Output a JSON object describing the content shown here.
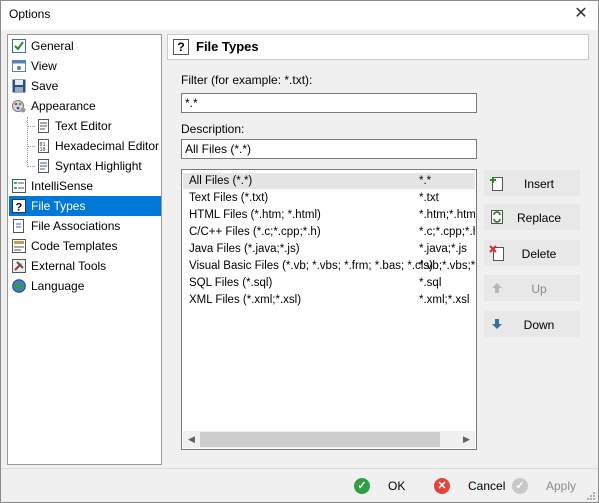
{
  "window": {
    "title": "Options"
  },
  "sidebar": {
    "items": [
      {
        "label": "General",
        "icon": "checkbox-icon"
      },
      {
        "label": "View",
        "icon": "view-icon"
      },
      {
        "label": "Save",
        "icon": "floppy-disk-icon"
      },
      {
        "label": "Appearance",
        "icon": "palette-gear-icon"
      },
      {
        "label": "Text Editor",
        "icon": "document-icon"
      },
      {
        "label": "Hexadecimal Editor",
        "icon": "binary-document-icon"
      },
      {
        "label": "Syntax Highlight",
        "icon": "highlight-document-icon"
      },
      {
        "label": "IntelliSense",
        "icon": "list-icon"
      },
      {
        "label": "File Types",
        "icon": "question-mark-icon"
      },
      {
        "label": "File Associations",
        "icon": "document-association-icon"
      },
      {
        "label": "Code Templates",
        "icon": "template-icon"
      },
      {
        "label": "External Tools",
        "icon": "tools-icon"
      },
      {
        "label": "Language",
        "icon": "globe-icon"
      }
    ],
    "selected_index": 8
  },
  "panel": {
    "title": "File Types",
    "filter_label": "Filter (for example: *.txt):",
    "filter_value": "*.*",
    "description_label": "Description:",
    "description_value": "All Files (*.*)",
    "file_types": [
      {
        "name": "All Files (*.*)",
        "pattern": "*.*"
      },
      {
        "name": "Text Files (*.txt)",
        "pattern": "*.txt"
      },
      {
        "name": "HTML Files (*.htm; *.html)",
        "pattern": "*.htm;*.html"
      },
      {
        "name": "C/C++ Files (*.c;*.cpp;*.h)",
        "pattern": "*.c;*.cpp;*.h"
      },
      {
        "name": "Java Files (*.java;*.js)",
        "pattern": "*.java;*.js"
      },
      {
        "name": "Visual Basic Files (*.vb; *.vbs; *.frm; *.bas; *.cls)",
        "pattern": "*.vb;*.vbs;*.frm"
      },
      {
        "name": "SQL Files (*.sql)",
        "pattern": "*.sql"
      },
      {
        "name": "XML Files (*.xml;*.xsl)",
        "pattern": "*.xml;*.xsl"
      }
    ],
    "selected_row": 0
  },
  "buttons": {
    "insert": "Insert",
    "replace": "Replace",
    "delete": "Delete",
    "up": "Up",
    "down": "Down"
  },
  "footer": {
    "ok": "OK",
    "cancel": "Cancel",
    "apply": "Apply"
  },
  "colors": {
    "selection": "#0078d7",
    "ok_green": "#2ea043",
    "cancel_red": "#e0443a"
  }
}
